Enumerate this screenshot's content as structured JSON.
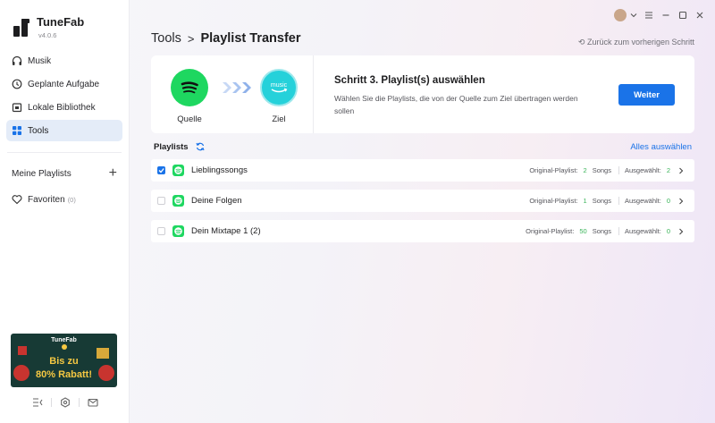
{
  "app": {
    "name": "TuneFab",
    "version": "v4.0.6"
  },
  "sidebar": {
    "items": [
      {
        "label": "Musik",
        "icon": "headphones-icon"
      },
      {
        "label": "Geplante Aufgabe",
        "icon": "clock-icon"
      },
      {
        "label": "Lokale Bibliothek",
        "icon": "library-icon"
      },
      {
        "label": "Tools",
        "icon": "grid-icon",
        "active": true
      }
    ],
    "my_playlists_label": "Meine Playlists",
    "favorites_label": "Favoriten",
    "favorites_count": "(0)",
    "promo": {
      "brand": "TuneFab",
      "line1": "Bis zu",
      "line2": "80% Rabatt!"
    }
  },
  "header": {
    "breadcrumb_root": "Tools",
    "breadcrumb_sep": ">",
    "breadcrumb_current": "Playlist Transfer",
    "back_link": "⟲ Zurück zum vorherigen Schritt"
  },
  "step": {
    "source_label": "Quelle",
    "target_label": "Ziel",
    "target_badge": "music",
    "title": "Schritt 3. Playlist(s) auswählen",
    "description": "Wählen Sie die Playlists, die von der Quelle zum Ziel übertragen werden sollen",
    "next_button": "Weiter"
  },
  "playlists": {
    "header": "Playlists",
    "select_all": "Alles auswählen",
    "original_label": "Original-Playlist:",
    "songs_label": "Songs",
    "selected_label": "Ausgewählt:",
    "rows": [
      {
        "name": "Lieblingssongs",
        "original": "2",
        "selected": "2",
        "checked": true
      },
      {
        "name": "Deine Folgen",
        "original": "1",
        "selected": "0",
        "checked": false
      },
      {
        "name": "Dein Mixtape 1 (2)",
        "original": "50",
        "selected": "0",
        "checked": false
      }
    ]
  },
  "colors": {
    "accent": "#1a73e8",
    "spotify": "#1ed760",
    "amazon": "#25d1da",
    "count_green": "#3bb55a"
  }
}
